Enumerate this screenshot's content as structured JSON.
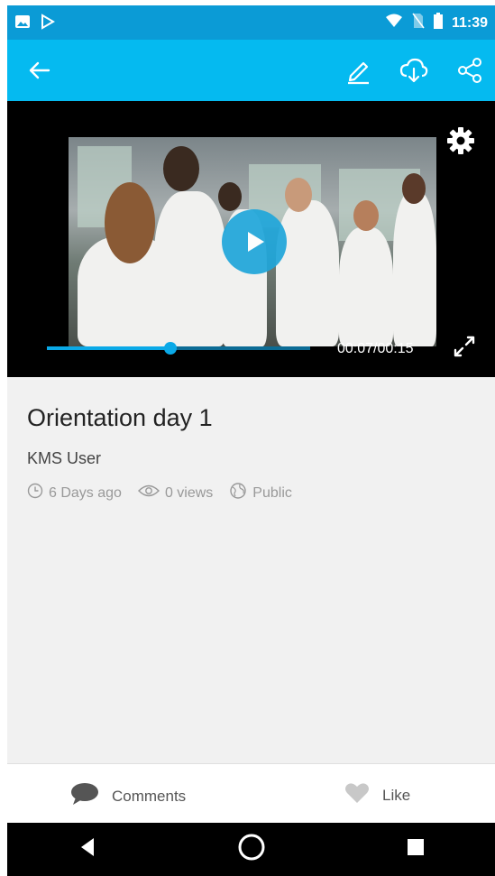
{
  "status_bar": {
    "time": "11:39",
    "icons": [
      "image-icon",
      "play-store-icon",
      "wifi-icon",
      "no-sim-icon",
      "battery-icon"
    ]
  },
  "app_bar": {
    "icons": [
      "back-arrow-icon",
      "edit-icon",
      "cloud-download-icon",
      "share-icon"
    ],
    "color": "#05baf0"
  },
  "video": {
    "timecode": "00:07/00:15",
    "progress": 0.47,
    "icons": [
      "settings-gear-icon",
      "play-icon",
      "fullscreen-icon"
    ],
    "accent": "#0aa9e7"
  },
  "details": {
    "title": "Orientation day 1",
    "owner": "KMS User",
    "created": "6 Days ago",
    "views": "0 views",
    "privacy": "Public"
  },
  "actions": {
    "comments_label": "Comments",
    "like_label": "Like"
  },
  "nav": {
    "icons": [
      "nav-back-icon",
      "nav-home-icon",
      "nav-recents-icon"
    ]
  }
}
